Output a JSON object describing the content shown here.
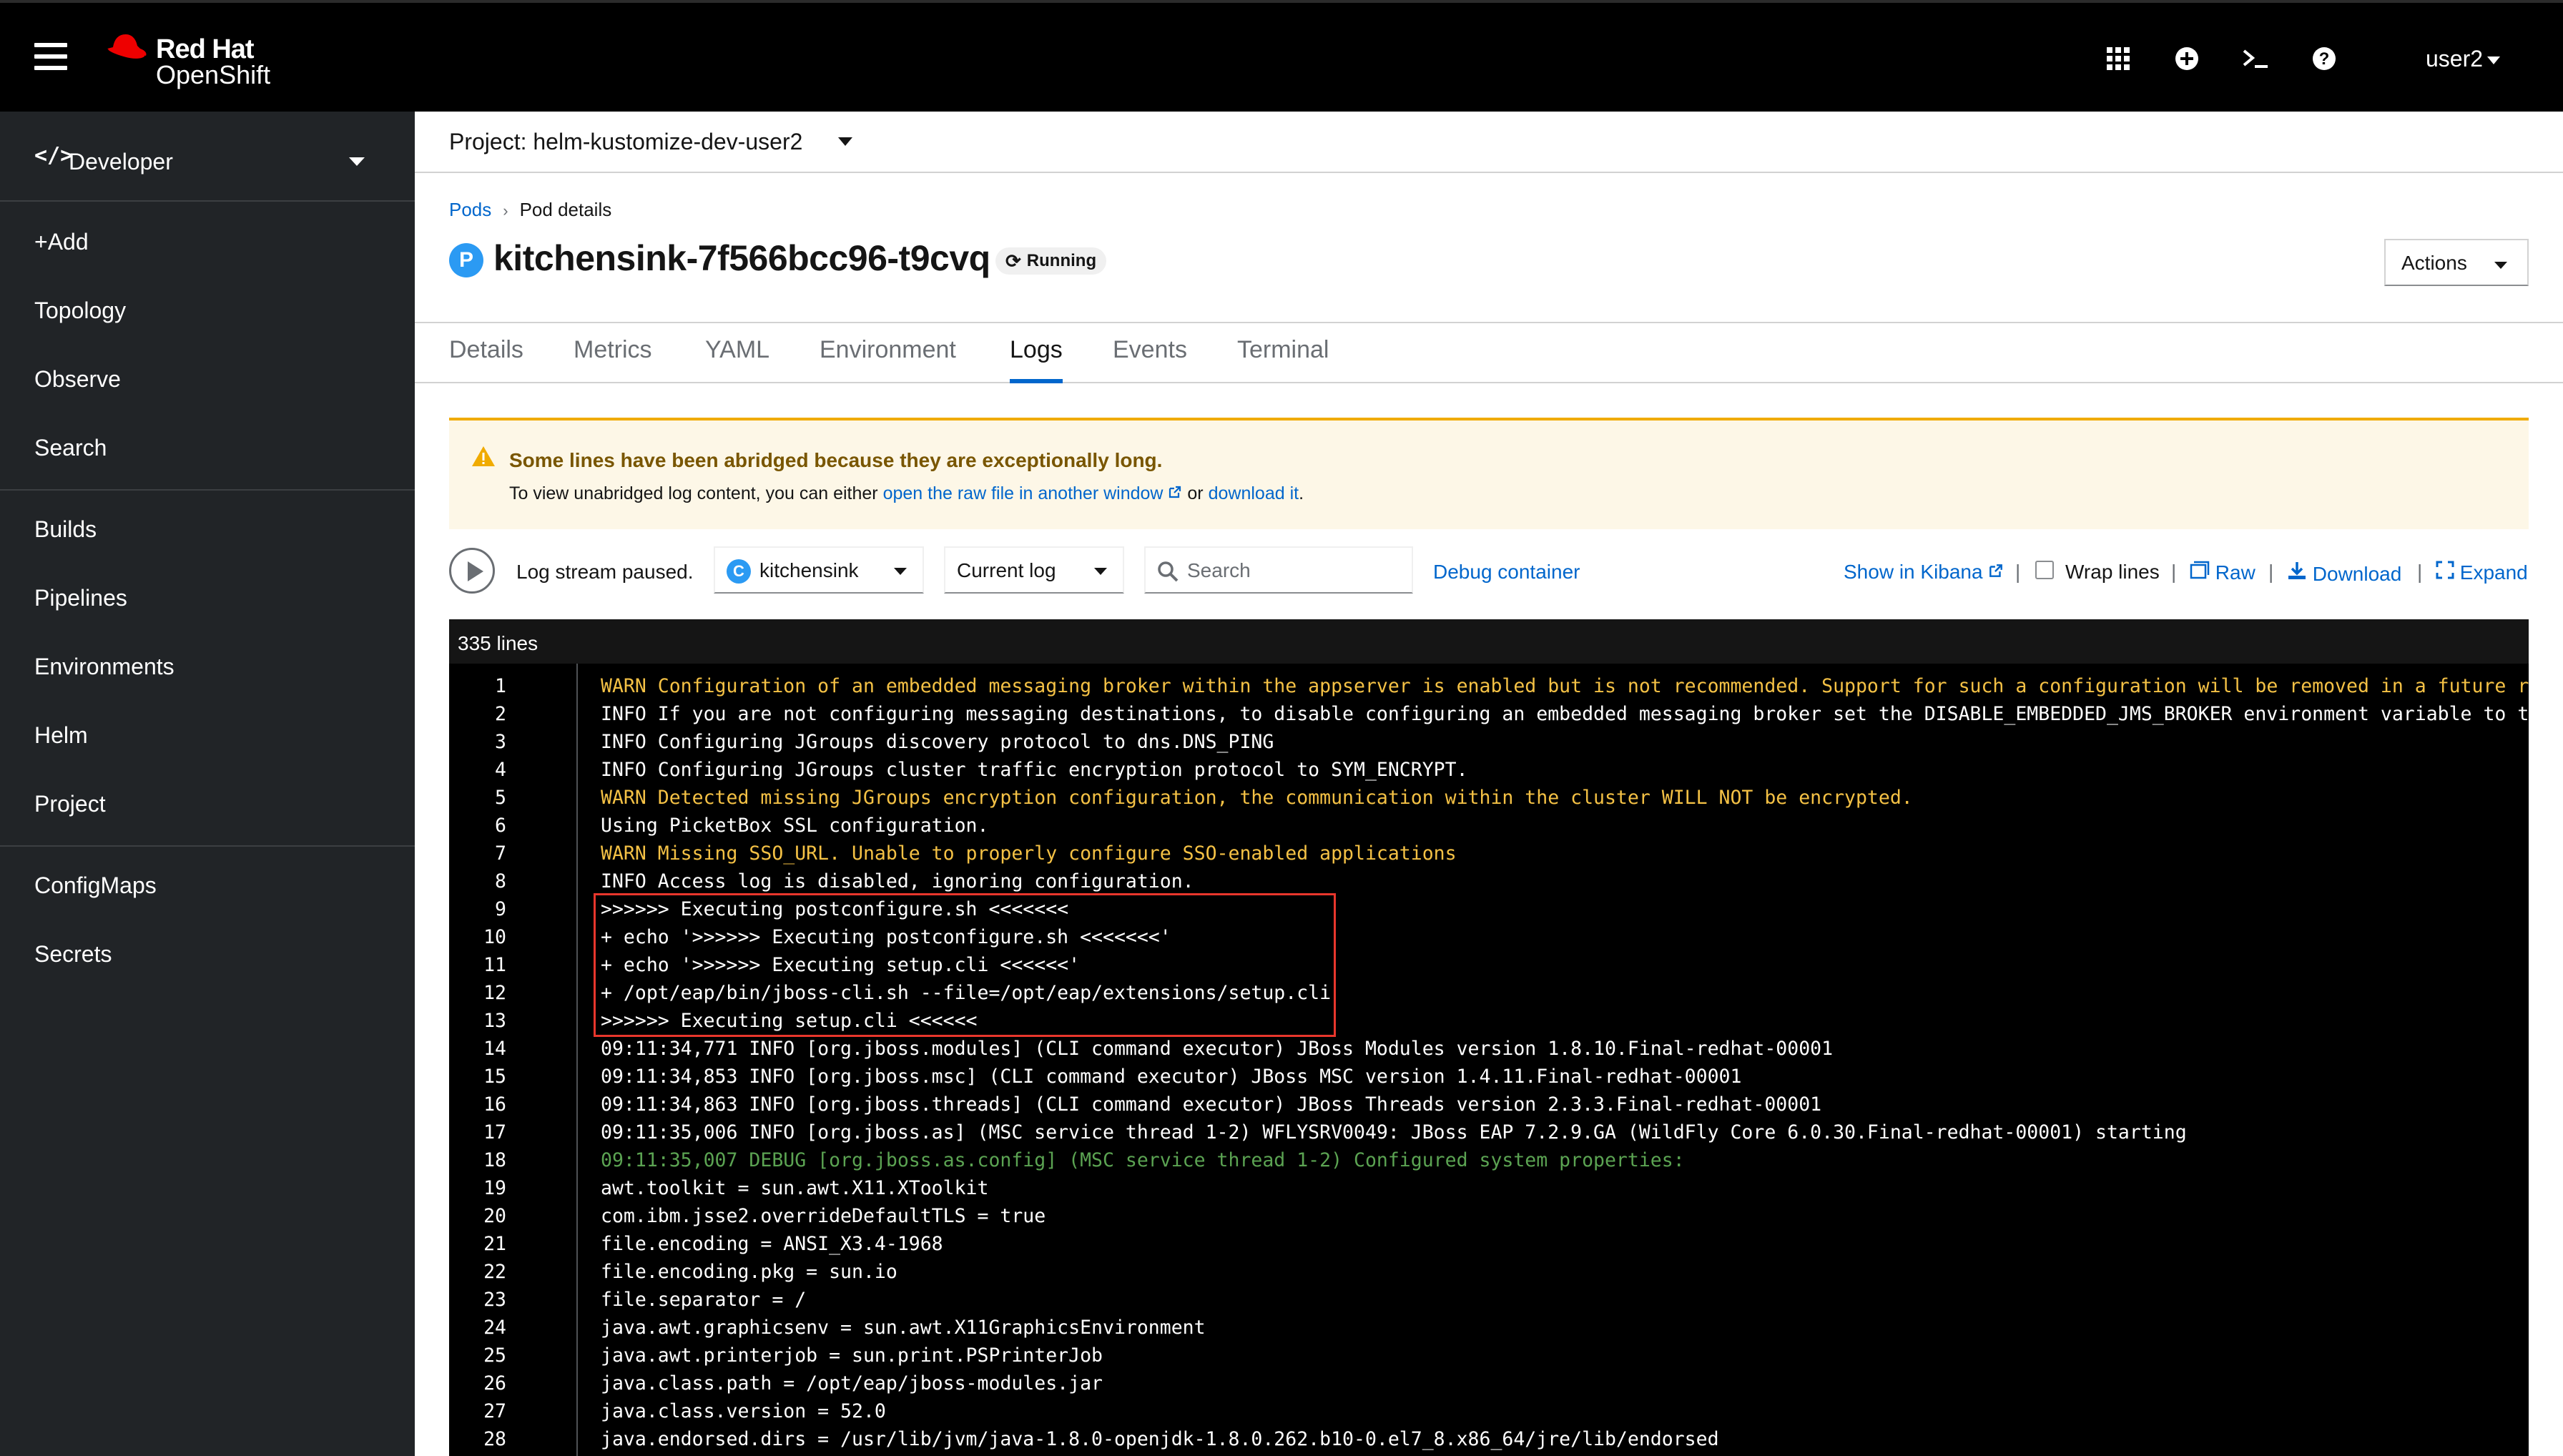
{
  "masthead": {
    "brand_line1": "Red Hat",
    "brand_line2": "OpenShift",
    "user": "user2",
    "icons": [
      "menu-icon",
      "app-launcher-icon",
      "add-icon",
      "terminal-icon",
      "help-icon"
    ]
  },
  "sidebar": {
    "perspective": "Developer",
    "group1": [
      "+Add",
      "Topology",
      "Observe",
      "Search"
    ],
    "group2": [
      "Builds",
      "Pipelines",
      "Environments",
      "Helm",
      "Project"
    ],
    "group3": [
      "ConfigMaps",
      "Secrets"
    ]
  },
  "project_bar": {
    "label": "Project: helm-kustomize-dev-user2"
  },
  "breadcrumb": {
    "link": "Pods",
    "current": "Pod details"
  },
  "pod": {
    "badge": "P",
    "name": "kitchensink-7f566bcc96-t9cvq",
    "status": "Running",
    "actions_label": "Actions"
  },
  "tabs": [
    "Details",
    "Metrics",
    "YAML",
    "Environment",
    "Logs",
    "Events",
    "Terminal"
  ],
  "active_tab": "Logs",
  "alert": {
    "title": "Some lines have been abridged because they are exceptionally long.",
    "body_prefix": "To view unabridged log content, you can either",
    "link_raw": "open the raw file in another window",
    "body_mid": "or",
    "link_download": "download it",
    "body_suffix": "."
  },
  "toolbar": {
    "stream_status": "Log stream paused.",
    "container_badge": "C",
    "container": "kitchensink",
    "log_type": "Current log",
    "search_placeholder": "Search",
    "debug": "Debug container",
    "kibana": "Show in Kibana",
    "wrap": "Wrap lines",
    "raw": "Raw",
    "download": "Download",
    "expand": "Expand",
    "wrap_checked": false
  },
  "log": {
    "line_count": "335 lines",
    "highlighted_lines": [
      9,
      13
    ],
    "colors": {
      "info": "#ffffff",
      "warn": "#f4c145",
      "debug": "#5ba352",
      "highlight": "#e8362c"
    },
    "lines": [
      {
        "n": "1",
        "level": "warn",
        "text": "WARN Configuration of an embedded messaging broker within the appserver is enabled but is not recommended. Support for such a configuration will be removed in a future rele"
      },
      {
        "n": "2",
        "level": "info",
        "text": "INFO If you are not configuring messaging destinations, to disable configuring an embedded messaging broker set the DISABLE_EMBEDDED_JMS_BROKER environment variable to true"
      },
      {
        "n": "3",
        "level": "info",
        "text": "INFO Configuring JGroups discovery protocol to dns.DNS_PING"
      },
      {
        "n": "4",
        "level": "info",
        "text": "INFO Configuring JGroups cluster traffic encryption protocol to SYM_ENCRYPT."
      },
      {
        "n": "5",
        "level": "warn",
        "text": "WARN Detected missing JGroups encryption configuration, the communication within the cluster WILL NOT be encrypted."
      },
      {
        "n": "6",
        "level": "info",
        "text": "Using PicketBox SSL configuration."
      },
      {
        "n": "7",
        "level": "warn",
        "text": "WARN Missing SSO_URL. Unable to properly configure SSO-enabled applications"
      },
      {
        "n": "8",
        "level": "info",
        "text": "INFO Access log is disabled, ignoring configuration."
      },
      {
        "n": "9",
        "level": "info",
        "text": ">>>>>> Executing postconfigure.sh <<<<<<<"
      },
      {
        "n": "10",
        "level": "info",
        "text": "+ echo '>>>>>> Executing postconfigure.sh <<<<<<<'"
      },
      {
        "n": "11",
        "level": "info",
        "text": "+ echo '>>>>>> Executing setup.cli <<<<<<'"
      },
      {
        "n": "12",
        "level": "info",
        "text": "+ /opt/eap/bin/jboss-cli.sh --file=/opt/eap/extensions/setup.cli"
      },
      {
        "n": "13",
        "level": "info",
        "text": ">>>>>> Executing setup.cli <<<<<<"
      },
      {
        "n": "14",
        "level": "info",
        "text": "09:11:34,771 INFO [org.jboss.modules] (CLI command executor) JBoss Modules version 1.8.10.Final-redhat-00001"
      },
      {
        "n": "15",
        "level": "info",
        "text": "09:11:34,853 INFO [org.jboss.msc] (CLI command executor) JBoss MSC version 1.4.11.Final-redhat-00001"
      },
      {
        "n": "16",
        "level": "info",
        "text": "09:11:34,863 INFO [org.jboss.threads] (CLI command executor) JBoss Threads version 2.3.3.Final-redhat-00001"
      },
      {
        "n": "17",
        "level": "info",
        "text": "09:11:35,006 INFO [org.jboss.as] (MSC service thread 1-2) WFLYSRV0049: JBoss EAP 7.2.9.GA (WildFly Core 6.0.30.Final-redhat-00001) starting"
      },
      {
        "n": "18",
        "level": "debug",
        "text": "09:11:35,007 DEBUG [org.jboss.as.config] (MSC service thread 1-2) Configured system properties:"
      },
      {
        "n": "19",
        "level": "info",
        "text": "awt.toolkit = sun.awt.X11.XToolkit"
      },
      {
        "n": "20",
        "level": "info",
        "text": "com.ibm.jsse2.overrideDefaultTLS = true"
      },
      {
        "n": "21",
        "level": "info",
        "text": "file.encoding = ANSI_X3.4-1968"
      },
      {
        "n": "22",
        "level": "info",
        "text": "file.encoding.pkg = sun.io"
      },
      {
        "n": "23",
        "level": "info",
        "text": "file.separator = /"
      },
      {
        "n": "24",
        "level": "info",
        "text": "java.awt.graphicsenv = sun.awt.X11GraphicsEnvironment"
      },
      {
        "n": "25",
        "level": "info",
        "text": "java.awt.printerjob = sun.print.PSPrinterJob"
      },
      {
        "n": "26",
        "level": "info",
        "text": "java.class.path = /opt/eap/jboss-modules.jar"
      },
      {
        "n": "27",
        "level": "info",
        "text": "java.class.version = 52.0"
      },
      {
        "n": "28",
        "level": "info",
        "text": "java.endorsed.dirs = /usr/lib/jvm/java-1.8.0-openjdk-1.8.0.262.b10-0.el7_8.x86_64/jre/lib/endorsed"
      }
    ]
  }
}
